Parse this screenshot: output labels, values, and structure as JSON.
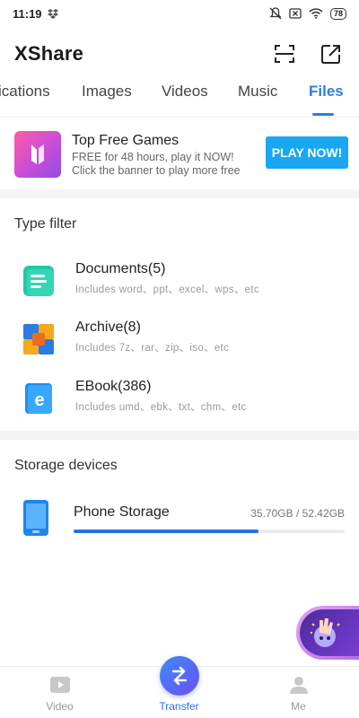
{
  "status_bar": {
    "time": "11:19",
    "battery": "78"
  },
  "header": {
    "title": "XShare",
    "actions": [
      "scan-icon",
      "share-out-icon"
    ]
  },
  "tabs": [
    {
      "label": "ications"
    },
    {
      "label": "Images"
    },
    {
      "label": "Videos"
    },
    {
      "label": "Music"
    },
    {
      "label": "Files",
      "active": true
    }
  ],
  "banner": {
    "title": "Top Free Games",
    "line1": "FREE for 48 hours, play it NOW!",
    "line2": "Click the banner to play more free",
    "button": "PLAY NOW!"
  },
  "type_filter": {
    "title": "Type filter",
    "items": [
      {
        "name": "Documents(5)",
        "desc": "Includes word、ppt、excel、wps、etc",
        "icon": "document-icon"
      },
      {
        "name": "Archive(8)",
        "desc": "Includes 7z、rar、zip、iso、etc",
        "icon": "archive-icon"
      },
      {
        "name": "EBook(386)",
        "desc": "Includes umd、ebk、txt、chm、etc",
        "icon": "ebook-icon"
      }
    ]
  },
  "storage": {
    "title": "Storage devices",
    "device": {
      "name": "Phone Storage",
      "size": "35.70GB / 52.42GB",
      "usage_fraction": 0.681
    }
  },
  "bottom_nav": [
    {
      "label": "Video"
    },
    {
      "label": "Transfer",
      "active": true
    },
    {
      "label": "Me"
    }
  ],
  "colors": {
    "accent": "#2d7de0",
    "play_button": "#19a7f3",
    "progress": "#2d6fe3"
  }
}
